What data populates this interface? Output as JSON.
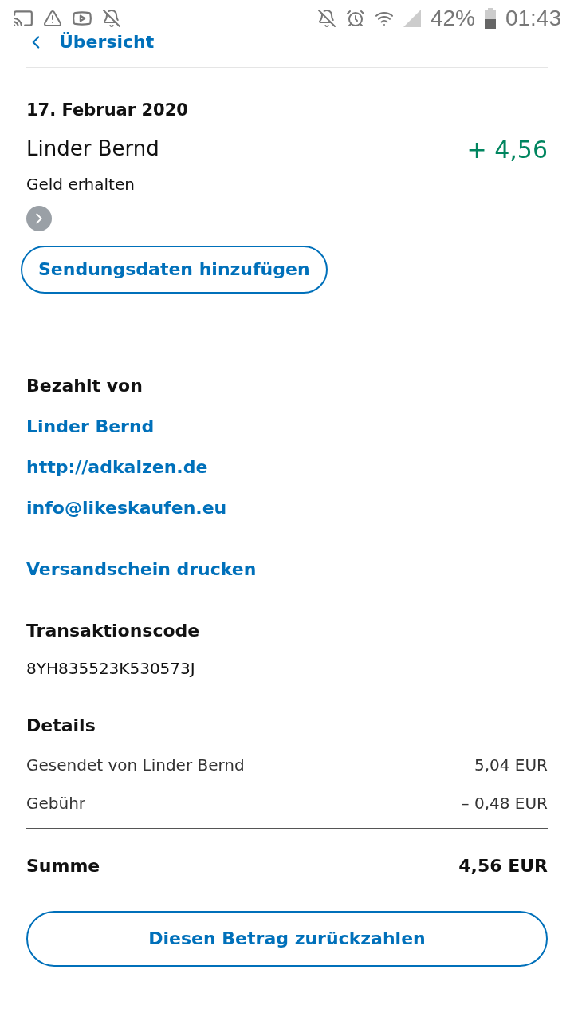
{
  "status_bar": {
    "battery": "42%",
    "time": "01:43"
  },
  "back_link": {
    "label": "Übersicht"
  },
  "transaction": {
    "date": "17. Februar 2020",
    "name": "Linder Bernd",
    "type": "Geld erhalten",
    "amount": "+ 4,56"
  },
  "shipping_button": "Sendungsdaten hinzufügen",
  "paid_by": {
    "heading": "Bezahlt von",
    "links": [
      "Linder Bernd",
      "http://adkaizen.de",
      "info@likeskaufen.eu"
    ]
  },
  "print_link": "Versandschein drucken",
  "transaction_code": {
    "heading": "Transaktionscode",
    "value": "8YH835523K530573J"
  },
  "details": {
    "heading": "Details",
    "rows": [
      {
        "label": "Gesendet von Linder Bernd",
        "value": "5,04 EUR"
      },
      {
        "label": "Gebühr",
        "value": "– 0,48 EUR"
      }
    ],
    "total": {
      "label": "Summe",
      "value": "4,56 EUR"
    }
  },
  "refund_button": "Diesen Betrag zurückzahlen"
}
